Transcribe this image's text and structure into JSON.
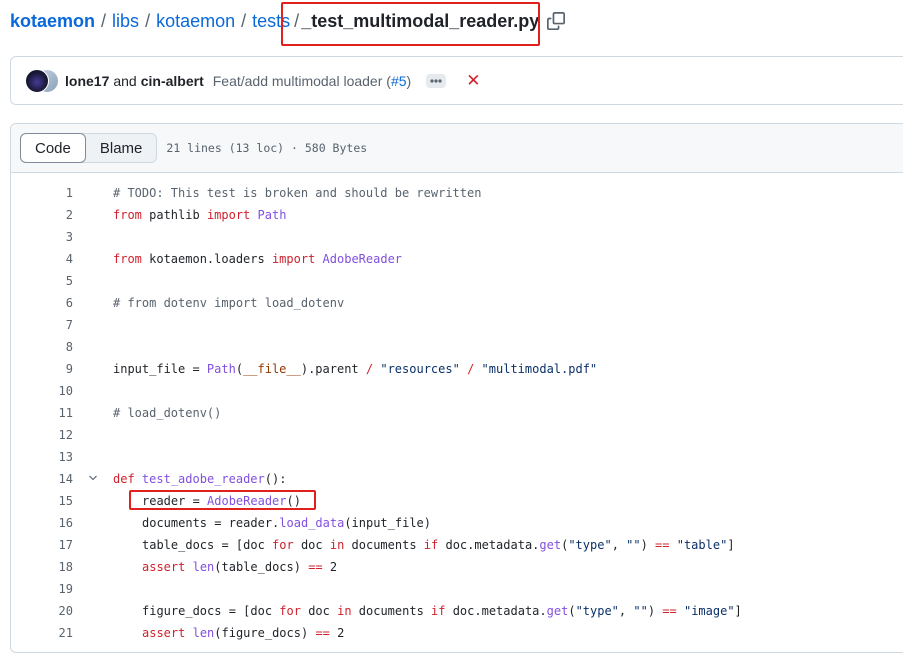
{
  "breadcrumb": {
    "repo": "kotaemon",
    "parts": [
      "libs",
      "kotaemon",
      "tests"
    ],
    "separator": "/",
    "current_file": "_test_multimodal_reader.py"
  },
  "commit": {
    "author1": "lone17",
    "and_text": "and",
    "author2": "cin-albert",
    "message": "Feat/add multimodal loader (",
    "pr": "#5",
    "message_end": ")",
    "status": "✕"
  },
  "file": {
    "tabs": [
      "Code",
      "Blame"
    ],
    "active_tab": "Code",
    "meta": "21 lines (13 loc) · 580 Bytes"
  },
  "code_lines": [
    {
      "n": "1",
      "t": "# TODO: This test is broken and should be rewritten"
    },
    {
      "n": "2",
      "t": "from pathlib import Path"
    },
    {
      "n": "3",
      "t": ""
    },
    {
      "n": "4",
      "t": "from kotaemon.loaders import AdobeReader"
    },
    {
      "n": "5",
      "t": ""
    },
    {
      "n": "6",
      "t": "# from dotenv import load_dotenv"
    },
    {
      "n": "7",
      "t": ""
    },
    {
      "n": "8",
      "t": ""
    },
    {
      "n": "9",
      "t": "input_file = Path(__file__).parent / \"resources\" / \"multimodal.pdf\""
    },
    {
      "n": "10",
      "t": ""
    },
    {
      "n": "11",
      "t": "# load_dotenv()"
    },
    {
      "n": "12",
      "t": ""
    },
    {
      "n": "13",
      "t": ""
    },
    {
      "n": "14",
      "t": "def test_adobe_reader():"
    },
    {
      "n": "15",
      "t": "reader = AdobeReader()"
    },
    {
      "n": "16",
      "t": "documents = reader.load_data(input_file)"
    },
    {
      "n": "17",
      "t": "table_docs = [doc for doc in documents if doc.metadata.get(\"type\", \"\") == \"table\"]"
    },
    {
      "n": "18",
      "t": "assert len(table_docs) == 2"
    },
    {
      "n": "19",
      "t": ""
    },
    {
      "n": "20",
      "t": "figure_docs = [doc for doc in documents if doc.metadata.get(\"type\", \"\") == \"image\"]"
    },
    {
      "n": "21",
      "t": "assert len(figure_docs) == 2"
    }
  ],
  "icons": {
    "copy": "copy-icon",
    "ellipsis": "kebab-horizontal-icon",
    "fold": "chevron-down-icon"
  },
  "colors": {
    "link": "#0969da",
    "keyword": "#cf222e",
    "function": "#8250df",
    "string": "#0a3069",
    "comment": "#59636e",
    "status_fail": "#d1242f",
    "highlight_box": "#e0201c"
  }
}
